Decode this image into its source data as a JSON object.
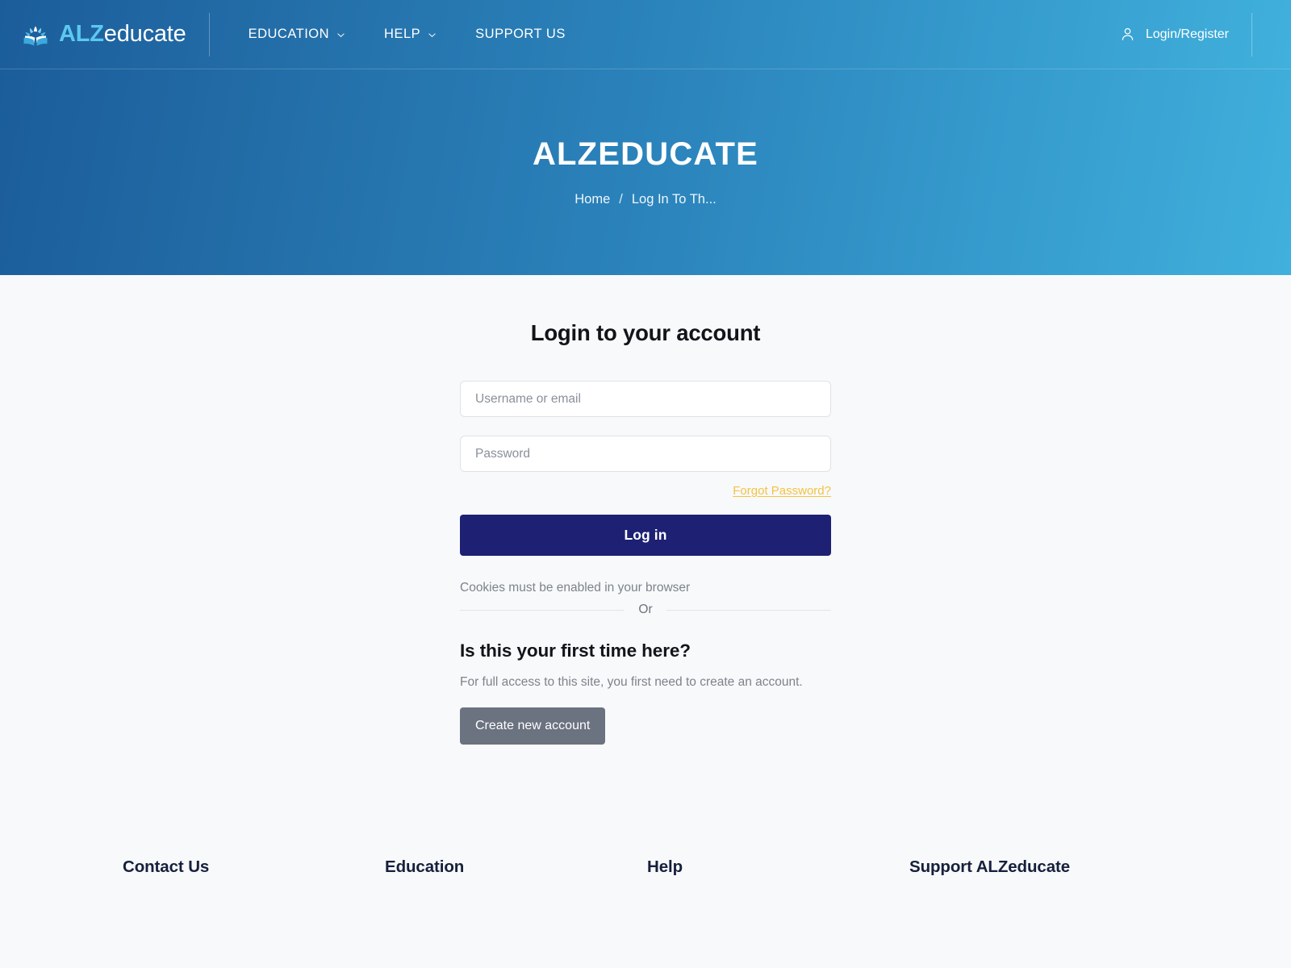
{
  "brand": {
    "icon": "lotus-book-icon",
    "name_accent": "ALZ",
    "name_rest": "educate"
  },
  "nav": {
    "items": [
      {
        "label": "EDUCATION",
        "has_dropdown": true,
        "icon": "chevron-down-icon"
      },
      {
        "label": "HELP",
        "has_dropdown": true,
        "icon": "chevron-down-icon"
      },
      {
        "label": "SUPPORT US",
        "has_dropdown": false
      }
    ],
    "account": {
      "icon": "user-icon",
      "label": "Login/Register"
    }
  },
  "hero": {
    "title": "ALZEDUCATE",
    "breadcrumb": {
      "home": "Home",
      "separator": "/",
      "current": "Log In To Th..."
    }
  },
  "login": {
    "heading": "Login to your account",
    "username": {
      "placeholder": "Username or email",
      "value": ""
    },
    "password": {
      "placeholder": "Password",
      "value": ""
    },
    "forgot_label": "Forgot Password?",
    "submit_label": "Log in",
    "cookies_note": "Cookies must be enabled in your browser",
    "or_label": "Or"
  },
  "signup": {
    "heading": "Is this your first time here?",
    "description": "For full access to this site, you first need to create an account.",
    "button_label": "Create new account"
  },
  "footer": {
    "columns": [
      {
        "heading": "Contact Us"
      },
      {
        "heading": "Education"
      },
      {
        "heading": "Help"
      },
      {
        "heading": "Support ALZeducate"
      }
    ]
  },
  "colors": {
    "header_gradient_start": "#1b5d9b",
    "header_gradient_end": "#40b0dc",
    "brand_accent": "#5dc8ef",
    "login_button": "#1d2073",
    "forgot_link": "#f3c342",
    "create_button": "#6b7280",
    "page_background": "#f8f9fa",
    "footer_heading": "#16203c"
  }
}
